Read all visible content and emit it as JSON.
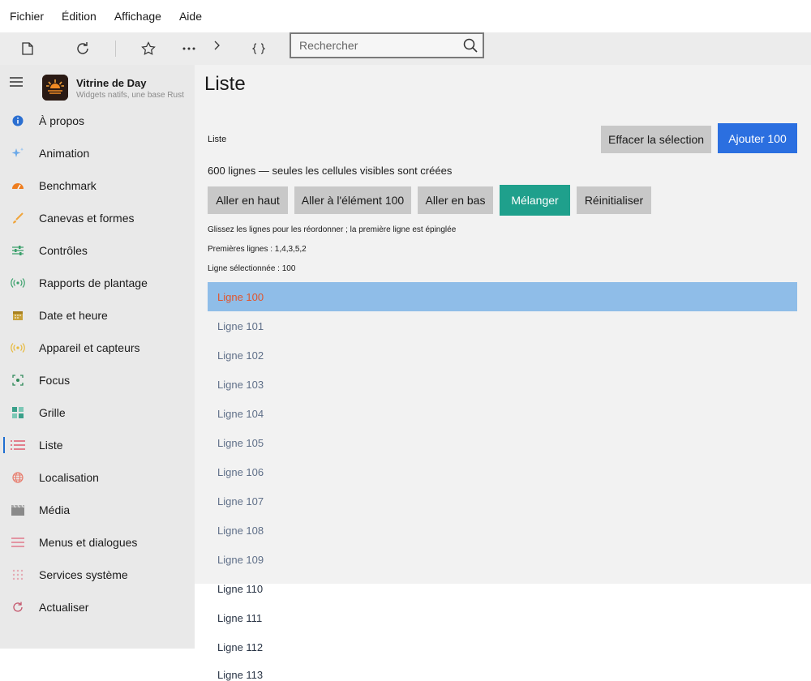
{
  "menu": [
    "Fichier",
    "Édition",
    "Affichage",
    "Aide"
  ],
  "toolbar": {
    "icons": [
      "new-document-icon",
      "refresh-icon",
      "star-icon",
      "more-icon",
      "chevron-right-icon",
      "braces-icon"
    ],
    "search_placeholder": "Rechercher"
  },
  "brand": {
    "title": "Vitrine de Day",
    "subtitle": "Widgets natifs, une base Rust"
  },
  "sidebar": {
    "items": [
      {
        "label": "À propos",
        "icon": "info-icon",
        "color": "#2b6fd1"
      },
      {
        "label": "Animation",
        "icon": "sparkle-icon",
        "color": "#6aa8e8"
      },
      {
        "label": "Benchmark",
        "icon": "gauge-icon",
        "color": "#ee7d1f"
      },
      {
        "label": "Canevas et formes",
        "icon": "brush-icon",
        "color": "#f0a53c"
      },
      {
        "label": "Contrôles",
        "icon": "sliders-icon",
        "color": "#3aa06b"
      },
      {
        "label": "Rapports de plantage",
        "icon": "broadcast-icon",
        "color": "#3aa06b"
      },
      {
        "label": "Date et heure",
        "icon": "calendar-icon",
        "color": "#c9a23b"
      },
      {
        "label": "Appareil et capteurs",
        "icon": "sensor-icon",
        "color": "#e8b93a"
      },
      {
        "label": "Focus",
        "icon": "focus-icon",
        "color": "#2f8a5a"
      },
      {
        "label": "Grille",
        "icon": "grid-icon",
        "color": "#3aa08a"
      },
      {
        "label": "Liste",
        "icon": "list-icon",
        "color": "#e05a6e"
      },
      {
        "label": "Localisation",
        "icon": "globe-icon",
        "color": "#e87a6a"
      },
      {
        "label": "Média",
        "icon": "clapper-icon",
        "color": "#8a8a8a"
      },
      {
        "label": "Menus et dialogues",
        "icon": "menu-lines-icon",
        "color": "#e0637a"
      },
      {
        "label": "Services système",
        "icon": "dots-grid-icon",
        "color": "#e4a9b3"
      },
      {
        "label": "Actualiser",
        "icon": "refresh-icon",
        "color": "#c4546a"
      }
    ],
    "active_index": 10
  },
  "page": {
    "title": "Liste",
    "section_label": "Liste",
    "clear_selection_label": "Effacer la sélection",
    "add_label": "Ajouter 100",
    "count_text": "600 lignes — seules les cellules visibles sont créées",
    "actions": [
      "Aller en haut",
      "Aller à l'élément 100",
      "Aller en bas",
      "Mélanger",
      "Réinitialiser"
    ],
    "hint": "Glissez les lignes pour les réordonner ; la première ligne est épinglée",
    "first_rows": "Premières lignes : 1,4,3,5,2",
    "selected_row": "Ligne sélectionnée : 100",
    "rows": [
      "Ligne 100",
      "Ligne 101",
      "Ligne 102",
      "Ligne 103",
      "Ligne 104",
      "Ligne 105",
      "Ligne 106",
      "Ligne 107",
      "Ligne 108",
      "Ligne 109",
      "Ligne 110",
      "Ligne 111",
      "Ligne 112",
      "Ligne 113"
    ]
  }
}
